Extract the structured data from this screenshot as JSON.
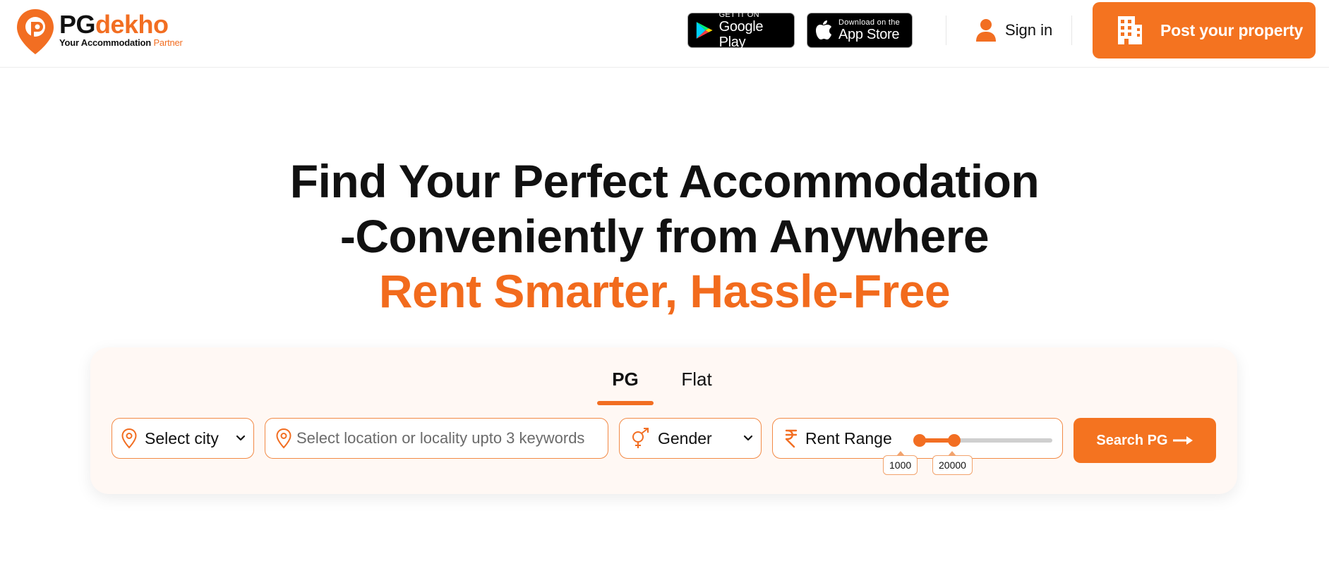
{
  "brand": {
    "name_part1": "PG",
    "name_part2": "dekho",
    "tagline_main": "Your Accommodation",
    "tagline_accent": "Partner",
    "color": "#f26e22"
  },
  "header": {
    "google_play": {
      "small": "GET IT ON",
      "big": "Google Play",
      "icon": "google-play-icon"
    },
    "app_store": {
      "small": "Download on the",
      "big": "App Store",
      "icon": "apple-icon"
    },
    "sign_in": "Sign in",
    "post_property": "Post your property"
  },
  "hero": {
    "line1": "Find Your Perfect Accommodation",
    "line2": "-Conveniently from Anywhere",
    "line3": "Rent Smarter, Hassle-Free"
  },
  "search": {
    "tabs": [
      {
        "label": "PG",
        "active": true
      },
      {
        "label": "Flat",
        "active": false
      }
    ],
    "city": {
      "label": "Select city",
      "icon": "location-pin-icon"
    },
    "location": {
      "placeholder": "Select location or locality upto 3 keywords",
      "icon": "location-pin-icon"
    },
    "gender": {
      "label": "Gender",
      "icon": "gender-icon"
    },
    "rent": {
      "label": "Rent Range",
      "icon": "rupee-icon",
      "min_value": "1000",
      "max_value": "20000",
      "min_fraction": 0.0,
      "max_fraction": 0.26
    },
    "button": "Search PG"
  }
}
